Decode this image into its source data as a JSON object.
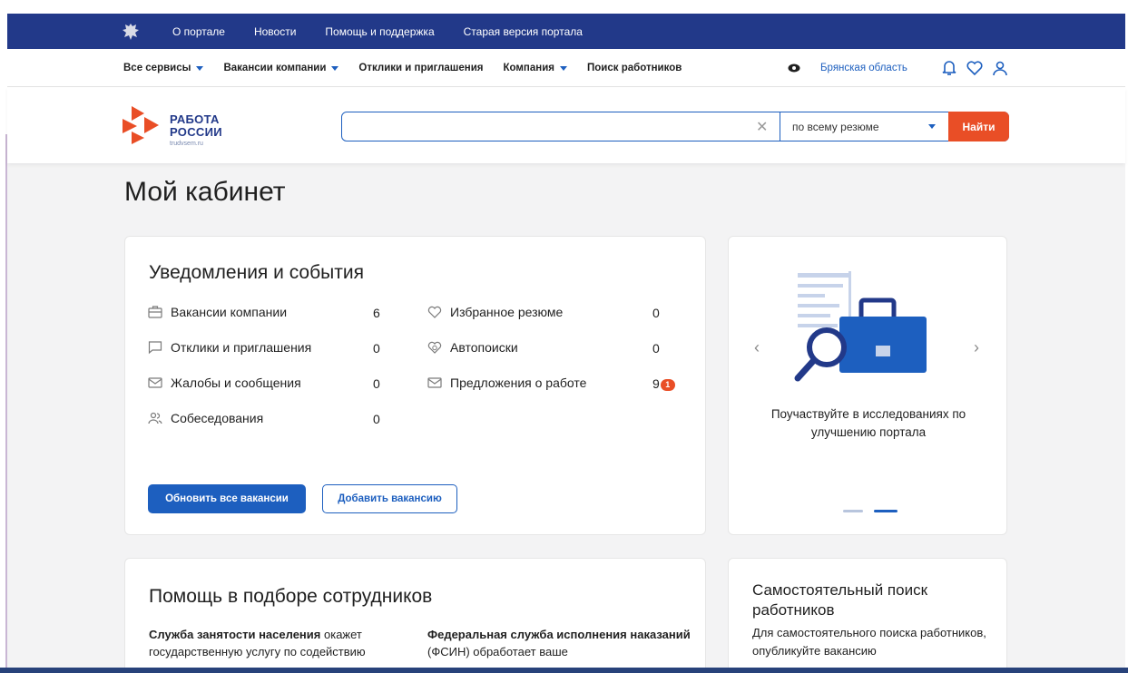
{
  "topbar": {
    "links": [
      "О портале",
      "Новости",
      "Помощь и поддержка",
      "Старая версия портала"
    ]
  },
  "nav": {
    "items": [
      {
        "label": "Все сервисы",
        "dropdown": true
      },
      {
        "label": "Вакансии компании",
        "dropdown": true
      },
      {
        "label": "Отклики и приглашения",
        "dropdown": false
      },
      {
        "label": "Компания",
        "dropdown": true
      },
      {
        "label": "Поиск работников",
        "dropdown": false
      }
    ],
    "region": "Брянская область"
  },
  "logo": {
    "line1": "РАБОТА",
    "line2": "РОССИИ",
    "domain": "trudvsem.ru"
  },
  "search": {
    "value": "",
    "scope": "по всему резюме",
    "button": "Найти"
  },
  "page_title": "Мой кабинет",
  "notifications": {
    "title": "Уведомления и события",
    "left": [
      {
        "icon": "briefcase-icon",
        "label": "Вакансии компании",
        "count": "6"
      },
      {
        "icon": "chat-icon",
        "label": "Отклики и приглашения",
        "count": "0"
      },
      {
        "icon": "mail-icon",
        "label": "Жалобы и сообщения",
        "count": "0"
      },
      {
        "icon": "people-icon",
        "label": "Собеседования",
        "count": "0"
      }
    ],
    "right": [
      {
        "icon": "heart-icon",
        "label": "Избранное резюме",
        "count": "0"
      },
      {
        "icon": "autosearch-icon",
        "label": "Автопоиски",
        "count": "0"
      },
      {
        "icon": "mail-icon",
        "label": "Предложения о работе",
        "count": "9",
        "badge": "1"
      }
    ],
    "btn_update": "Обновить все вакансии",
    "btn_add": "Добавить вакансию"
  },
  "promo": {
    "text": "Поучаствуйте в исследованиях по улучшению портала"
  },
  "help": {
    "title": "Помощь в подборе сотрудников",
    "col1_bold": "Служба занятости населения",
    "col1_text": " окажет государственную услугу по содействию",
    "col2_bold": "Федеральная служба исполнения наказаний",
    "col2_text": " (ФСИН) обработает ваше"
  },
  "selfsearch": {
    "title": "Самостоятельный поиск работников",
    "text": "Для самостоятельного поиска работников, опубликуйте вакансию"
  },
  "colors": {
    "brand_blue": "#223989",
    "accent_blue": "#1d5fbf",
    "accent_red": "#e94e26"
  }
}
